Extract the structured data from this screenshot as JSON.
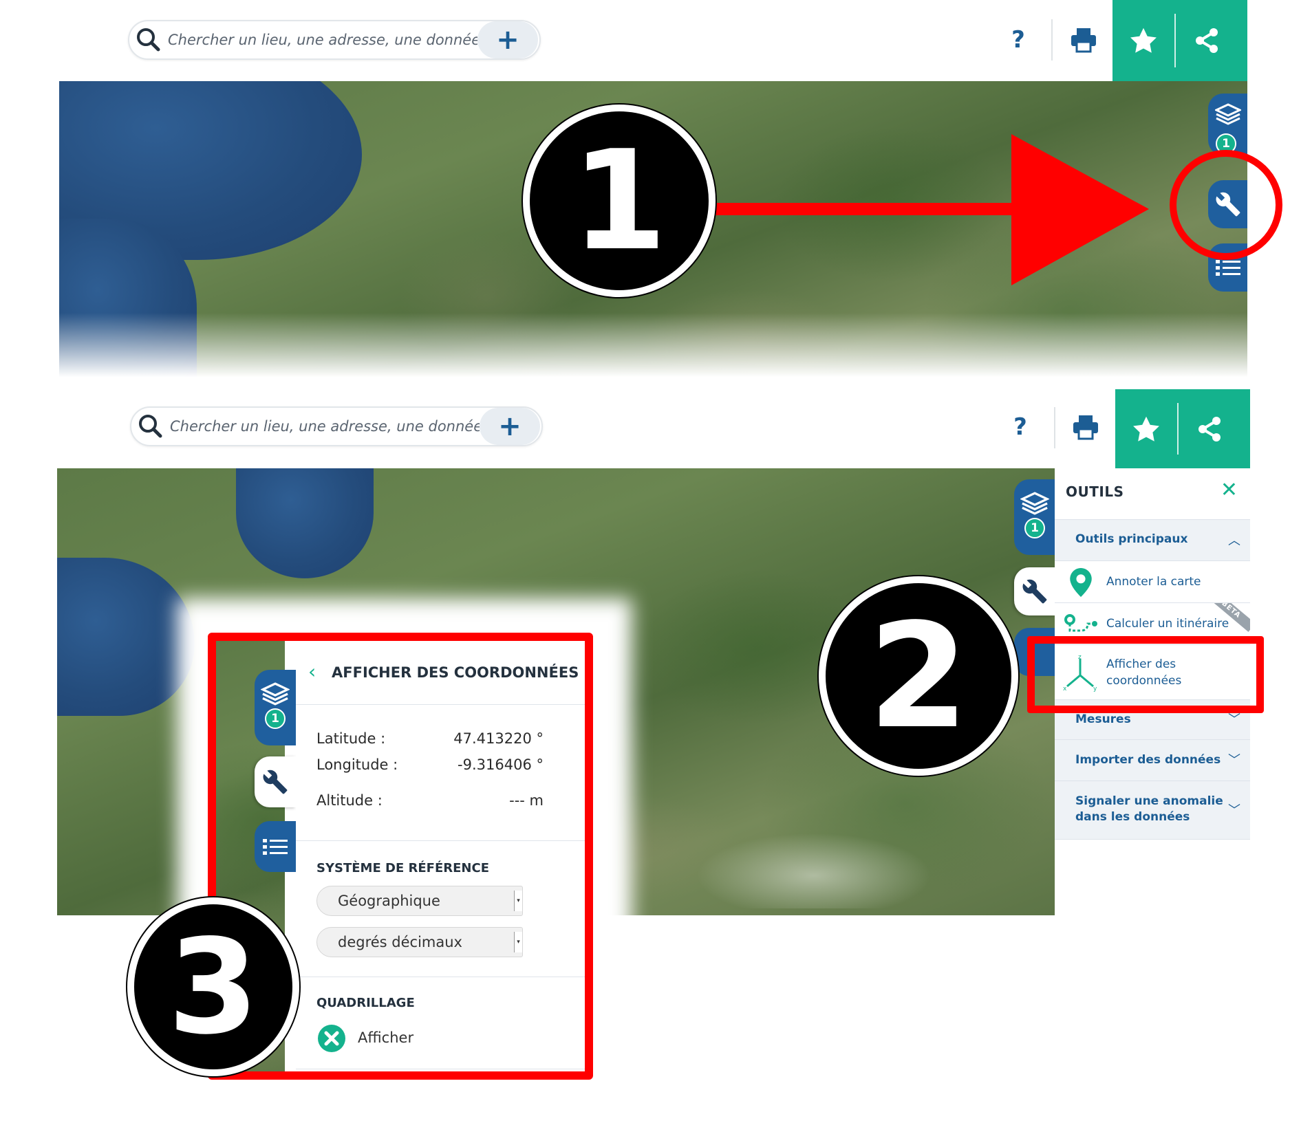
{
  "search": {
    "placeholder": "Chercher un lieu, une adresse, une donnée",
    "plus": "+"
  },
  "header": {
    "help": "?"
  },
  "map_tabs": {
    "layers_badge": "1"
  },
  "annotations": {
    "step1": "1",
    "step2": "2",
    "step3": "3",
    "highlight_color": "#ff0000"
  },
  "outils": {
    "title": "OUTILS",
    "close": "✕",
    "sections": {
      "main": "Outils principaux",
      "mesures": "Mesures",
      "import": "Importer des données",
      "signal": "Signaler une anomalie dans les données"
    },
    "items": {
      "annotate": "Annoter la carte",
      "route": "Calculer un itinéraire",
      "route_badge": "BETA",
      "coords_line1": "Afficher des",
      "coords_line2": "coordonnées"
    }
  },
  "coords_panel": {
    "title": "AFFICHER DES COORDONNÉES",
    "latitude_label": "Latitude :",
    "latitude_value": "47.413220 °",
    "longitude_label": "Longitude :",
    "longitude_value": "-9.316406 °",
    "altitude_label": "Altitude :",
    "altitude_value": "--- m",
    "ref_heading": "SYSTÈME DE RÉFÉRENCE",
    "system_select": "Géographique",
    "unit_select": "degrés décimaux",
    "grid_heading": "QUADRILLAGE",
    "grid_toggle": "Afficher"
  },
  "colors": {
    "brand_green": "#14b28d",
    "brand_blue": "#1c5d94",
    "tab_blue": "#1f5f9e"
  }
}
